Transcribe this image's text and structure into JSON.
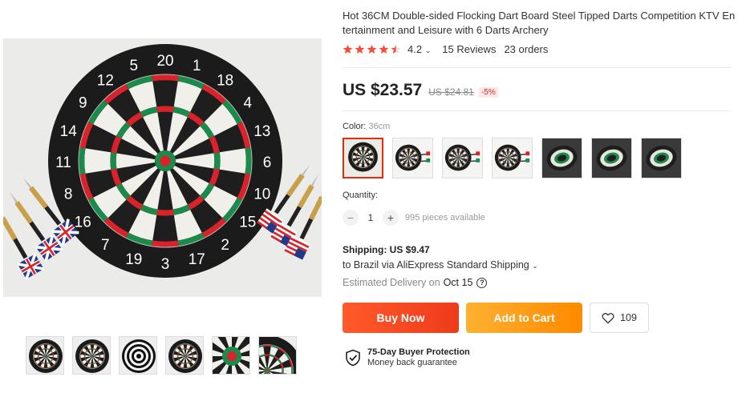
{
  "product": {
    "title": "Hot 36CM Double-sided Flocking Dart Board Steel Tipped Darts Competition KTV Entertainment and Leisure with 6 Darts Archery",
    "rating": "4.2",
    "rating_stars": 4.5,
    "reviews": "15 Reviews",
    "orders": "23 orders"
  },
  "price": {
    "current": "US $23.57",
    "original": "US $24.81",
    "discount": "-5%"
  },
  "color": {
    "label": "Color:",
    "value": "36cm",
    "swatch_count": 7,
    "selected_index": 0
  },
  "quantity": {
    "label": "Quantity:",
    "value": "1",
    "minus": "−",
    "plus": "+",
    "available": "995 pieces available"
  },
  "shipping": {
    "label": "Shipping: US $9.47",
    "to": "to Brazil via AliExpress Standard Shipping",
    "estimated_label": "Estimated Delivery on",
    "estimated_date": "Oct 15"
  },
  "actions": {
    "buy_now": "Buy Now",
    "add_to_cart": "Add to Cart",
    "wishlist_count": "109"
  },
  "protection": {
    "title": "75-Day Buyer Protection",
    "subtitle": "Money back guarantee"
  },
  "dartboard": {
    "numbers": [
      "20",
      "1",
      "18",
      "4",
      "13",
      "6",
      "10",
      "15",
      "2",
      "17",
      "3",
      "19",
      "7",
      "16",
      "8",
      "11",
      "14",
      "9",
      "12",
      "5"
    ]
  },
  "colors": {
    "accent_red": "#e62e04",
    "buy_now": "#f04a1e",
    "add_to_cart": "#ff9a1a",
    "star": "#f44e38"
  }
}
